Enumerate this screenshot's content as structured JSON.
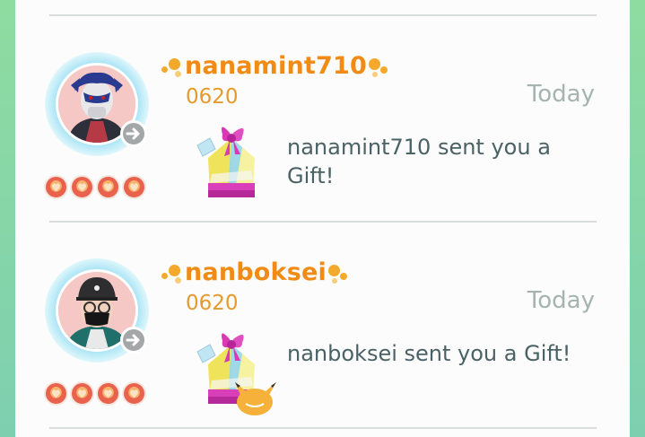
{
  "friends": [
    {
      "name": "nanamint710",
      "code": "0620",
      "date": "Today",
      "message": "nanamint710 sent you a Gift!",
      "hearts": 4,
      "avatar": "masked-trainer-avatar",
      "gift_sticker": false
    },
    {
      "name": "nanboksei",
      "code": "0620",
      "date": "Today",
      "message": "nanboksei sent you a Gift!",
      "hearts": 4,
      "avatar": "cap-mask-trainer-avatar",
      "gift_sticker": true
    }
  ],
  "colors": {
    "name": "#f08c16",
    "code": "#e79a2c",
    "date": "#a5b4b0",
    "message": "#4a6266",
    "background": "#8fdca0"
  }
}
